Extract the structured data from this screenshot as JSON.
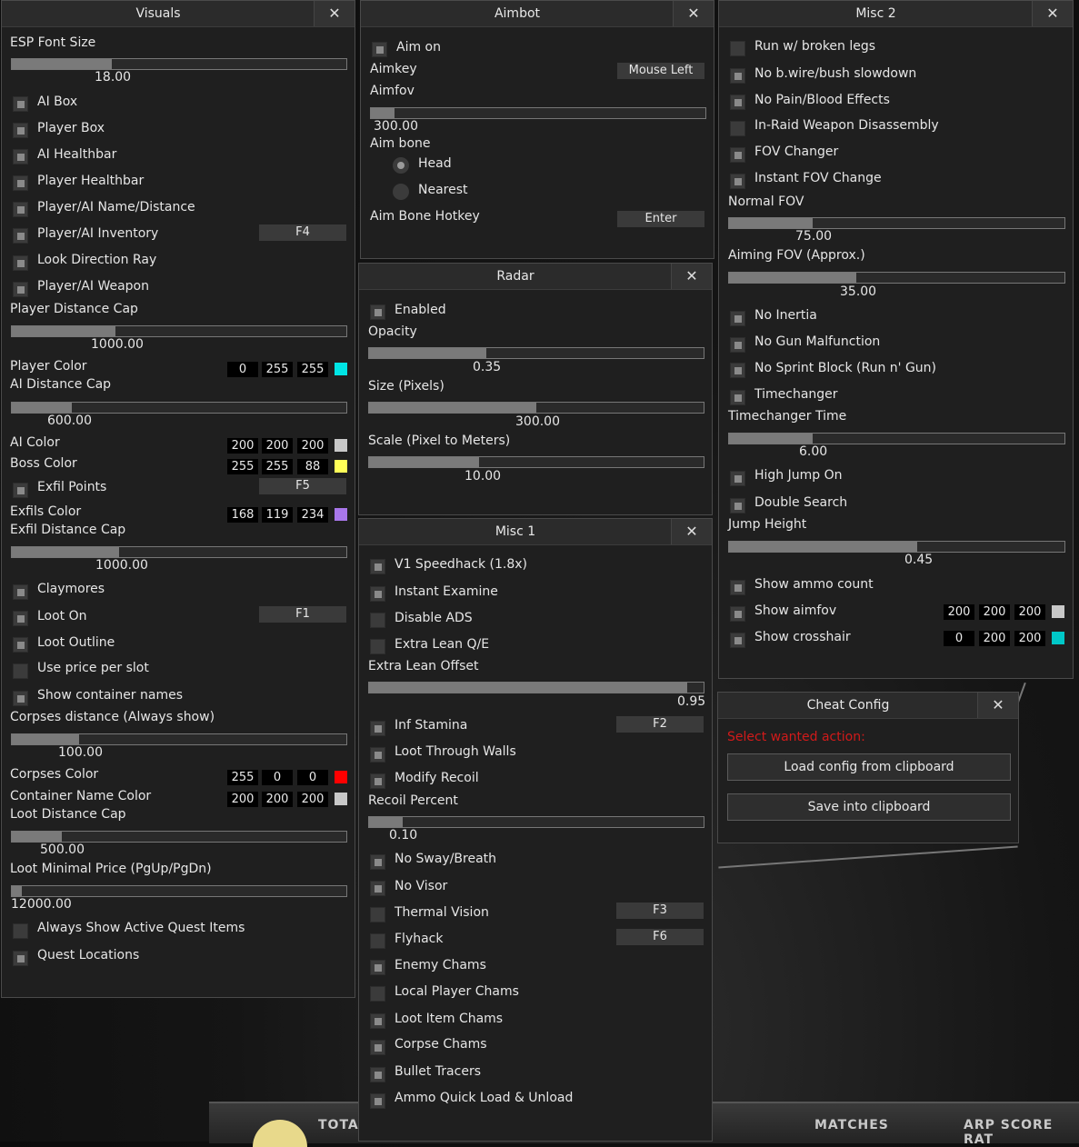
{
  "background": {
    "labels": [
      "TOTAL",
      "MATCHES",
      "ARP SCORE RAT"
    ]
  },
  "visuals": {
    "title": "Visuals",
    "close": "✕",
    "esp_font_size": {
      "label": "ESP Font Size",
      "value": "18.00",
      "fraction": 0.3
    },
    "ai_box": "AI Box",
    "player_box": "Player Box",
    "ai_healthbar": "AI Healthbar",
    "player_healthbar": "Player Healthbar",
    "name_distance": "Player/AI Name/Distance",
    "inventory": "Player/AI Inventory",
    "inventory_key": "F4",
    "look_ray": "Look Direction Ray",
    "weapon": "Player/AI Weapon",
    "player_distance_cap": {
      "label": "Player Distance Cap",
      "value": "1000.00",
      "fraction": 0.31
    },
    "player_color": {
      "label": "Player Color",
      "r": "0",
      "g": "255",
      "b": "255",
      "color": "#00e5e5"
    },
    "ai_distance_cap": {
      "label": "AI Distance Cap",
      "value": "600.00",
      "fraction": 0.18
    },
    "ai_color": {
      "label": "AI Color",
      "r": "200",
      "g": "200",
      "b": "200",
      "color": "#c8c8c8"
    },
    "boss_color": {
      "label": "Boss Color",
      "r": "255",
      "g": "255",
      "b": "88",
      "color": "#ffff58"
    },
    "exfil_points": "Exfil Points",
    "exfil_key": "F5",
    "exfils_color": {
      "label": "Exfils Color",
      "r": "168",
      "g": "119",
      "b": "234",
      "color": "#a877ea"
    },
    "exfil_distance_cap": {
      "label": "Exfil Distance Cap",
      "value": "1000.00",
      "fraction": 0.32
    },
    "claymores": "Claymores",
    "loot_on": "Loot On",
    "loot_key": "F1",
    "loot_outline": "Loot Outline",
    "price_per_slot": "Use price per slot",
    "container_names": "Show container names",
    "corpses_distance": {
      "label": "Corpses distance (Always show)",
      "value": "100.00",
      "fraction": 0.2
    },
    "corpses_color": {
      "label": "Corpses Color",
      "r": "255",
      "g": "0",
      "b": "0",
      "color": "#ff0000"
    },
    "container_color": {
      "label": "Container Name Color",
      "r": "200",
      "g": "200",
      "b": "200",
      "color": "#c8c8c8"
    },
    "loot_distance_cap": {
      "label": "Loot Distance Cap",
      "value": "500.00",
      "fraction": 0.15
    },
    "loot_min_price": {
      "label": "Loot Minimal Price (PgUp/PgDn)",
      "value": "12000.00",
      "fraction": 0.03
    },
    "quest_items": "Always Show Active Quest Items",
    "quest_locations": "Quest Locations"
  },
  "aimbot": {
    "title": "Aimbot",
    "close": "✕",
    "aim_on": "Aim on",
    "aimkey_label": "Aimkey",
    "aimkey_value": "Mouse Left",
    "aimfov": {
      "label": "Aimfov",
      "value": "300.00",
      "fraction": 0.07
    },
    "aim_bone_label": "Aim bone",
    "head": "Head",
    "nearest": "Nearest",
    "hotkey_label": "Aim Bone Hotkey",
    "hotkey_value": "Enter"
  },
  "radar": {
    "title": "Radar",
    "close": "✕",
    "enabled": "Enabled",
    "opacity": {
      "label": "Opacity",
      "value": "0.35",
      "fraction": 0.35
    },
    "size": {
      "label": "Size (Pixels)",
      "value": "300.00",
      "fraction": 0.5
    },
    "scale": {
      "label": "Scale (Pixel to Meters)",
      "value": "10.00",
      "fraction": 0.33
    }
  },
  "misc1": {
    "title": "Misc 1",
    "close": "✕",
    "speedhack": "V1 Speedhack (1.8x)",
    "instant_examine": "Instant Examine",
    "disable_ads": "Disable ADS",
    "extra_lean": "Extra Lean Q/E",
    "lean_offset": {
      "label": "Extra Lean Offset",
      "value": "0.95",
      "fraction": 0.95
    },
    "inf_stamina": "Inf Stamina",
    "stamina_key": "F2",
    "loot_through_walls": "Loot Through Walls",
    "modify_recoil": "Modify Recoil",
    "recoil_percent": {
      "label": "Recoil Percent",
      "value": "0.10",
      "fraction": 0.1
    },
    "no_sway": "No Sway/Breath",
    "no_visor": "No Visor",
    "thermal": "Thermal Vision",
    "thermal_key": "F3",
    "flyhack": "Flyhack",
    "flyhack_key": "F6",
    "enemy_chams": "Enemy Chams",
    "local_chams": "Local Player Chams",
    "loot_chams": "Loot Item Chams",
    "corpse_chams": "Corpse Chams",
    "bullet_tracers": "Bullet Tracers",
    "ammo_load": "Ammo Quick Load & Unload"
  },
  "misc2": {
    "title": "Misc 2",
    "close": "✕",
    "broken_legs": "Run w/ broken legs",
    "no_slowdown": "No b.wire/bush slowdown",
    "no_pain": "No Pain/Blood Effects",
    "disassembly": "In-Raid Weapon Disassembly",
    "fov_changer": "FOV Changer",
    "instant_fov": "Instant FOV Change",
    "normal_fov": {
      "label": "Normal FOV",
      "value": "75.00",
      "fraction": 0.25
    },
    "aiming_fov": {
      "label": "Aiming FOV (Approx.)",
      "value": "35.00",
      "fraction": 0.38
    },
    "no_inertia": "No Inertia",
    "no_malfunction": "No Gun Malfunction",
    "no_sprint_block": "No Sprint Block (Run n' Gun)",
    "timechanger": "Timechanger",
    "timechanger_time": {
      "label": "Timechanger Time",
      "value": "6.00",
      "fraction": 0.25
    },
    "high_jump": "High Jump On",
    "double_search": "Double Search",
    "jump_height": {
      "label": "Jump Height",
      "value": "0.45",
      "fraction": 0.56
    },
    "ammo_count": "Show ammo count",
    "show_aimfov": {
      "label": "Show aimfov",
      "r": "200",
      "g": "200",
      "b": "200",
      "color": "#c8c8c8"
    },
    "show_crosshair": {
      "label": "Show crosshair",
      "r": "0",
      "g": "200",
      "b": "200",
      "color": "#00c8c8"
    }
  },
  "cheat_config": {
    "title": "Cheat Config",
    "close": "✕",
    "prompt": "Select wanted action:",
    "load": "Load config from clipboard",
    "save": "Save into clipboard"
  }
}
